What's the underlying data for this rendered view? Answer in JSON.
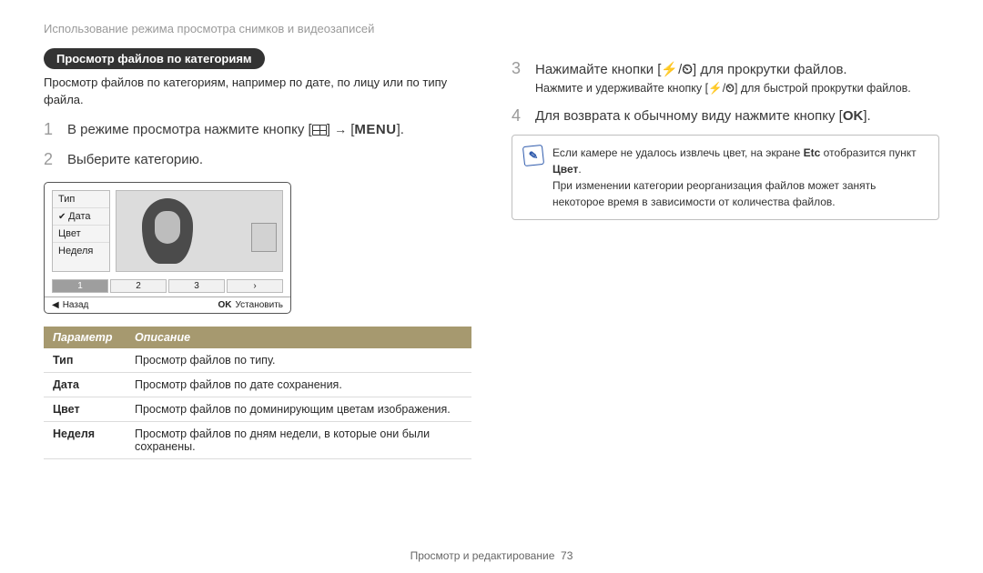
{
  "breadcrumb": "Использование режима просмотра снимков и видеозаписей",
  "pill": "Просмотр файлов по категориям",
  "intro": "Просмотр файлов по категориям, например по дате, по лицу или по типу файла.",
  "steps": {
    "s1": {
      "num": "1",
      "pre": "В режиме просмотра нажмите кнопку [",
      "menu": "MENU",
      "post": "]."
    },
    "s2": {
      "num": "2",
      "text": "Выберите категорию."
    },
    "s3": {
      "num": "3",
      "pre": "Нажимайте кнопки [",
      "post": "] для прокрутки файлов."
    },
    "s3sub": {
      "pre": "Нажмите и удерживайте кнопку [",
      "post": "] для быстрой прокрутки файлов."
    },
    "s4": {
      "num": "4",
      "pre": "Для возврата к обычному виду нажмите кнопку [",
      "ok": "OK",
      "post": "]."
    }
  },
  "camera": {
    "menu": [
      "Тип",
      "Дата",
      "Цвет",
      "Неделя"
    ],
    "activeIndex": 1,
    "pager": [
      "1",
      "2",
      "3",
      "›"
    ],
    "footer": {
      "back": "Назад",
      "set": "Установить",
      "ok": "OK",
      "left": "◀"
    }
  },
  "table": {
    "head": [
      "Параметр",
      "Описание"
    ],
    "rows": [
      [
        "Тип",
        "Просмотр файлов по типу."
      ],
      [
        "Дата",
        "Просмотр файлов по дате сохранения."
      ],
      [
        "Цвет",
        "Просмотр файлов по доминирующим цветам изображения."
      ],
      [
        "Неделя",
        "Просмотр файлов по дням недели, в которые они были сохранены."
      ]
    ]
  },
  "note": {
    "l1a": "Если камере не удалось извлечь цвет, на экране ",
    "l1b": "Etc",
    "l1c": " отобразится пункт ",
    "l1d": "Цвет",
    "l1e": ".",
    "l2": "При изменении категории реорганизация файлов может занять некоторое время в зависимости от количества файлов."
  },
  "icons": {
    "flash": "⚡",
    "timer": "⏲",
    "sep": "/"
  },
  "footer": {
    "section": "Просмотр и редактирование",
    "page": "73"
  }
}
